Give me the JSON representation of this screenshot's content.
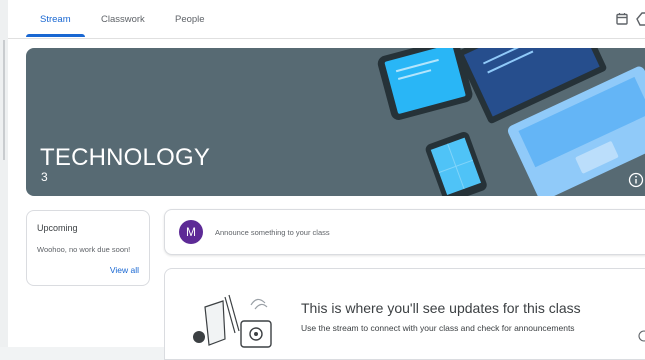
{
  "tabs": [
    {
      "label": "Stream",
      "active": true
    },
    {
      "label": "Classwork",
      "active": false
    },
    {
      "label": "People",
      "active": false
    }
  ],
  "toolbar": {
    "calendar_icon": "calendar-icon",
    "drive_icon": "drive-icon"
  },
  "banner": {
    "title": "TECHNOLOGY",
    "subtitle": "3",
    "info_icon": "info-icon"
  },
  "upcoming": {
    "title": "Upcoming",
    "message": "Woohoo, no work due soon!",
    "link": "View all"
  },
  "announce": {
    "avatar_letter": "M",
    "placeholder": "Announce something to your class"
  },
  "updates": {
    "title": "This is where you'll see updates for this class",
    "subtitle": "Use the stream to connect with your class and check for announcements"
  },
  "colors": {
    "accent": "#1967d2",
    "banner": "#576a73",
    "avatar": "#5d2a96"
  }
}
